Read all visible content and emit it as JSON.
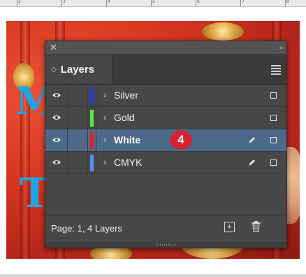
{
  "ruler": {
    "numbers": [
      "2",
      "3",
      "4",
      "5",
      "6",
      "7",
      "8"
    ]
  },
  "canvas": {
    "letters": [
      "M",
      "T"
    ]
  },
  "panel": {
    "tab_title": "Layers",
    "tab_icon": "up-down-arrows-icon",
    "close_glyph": "✕",
    "collapse_glyph": "‹‹",
    "menu_icon": "hamburger-menu-icon"
  },
  "layers": [
    {
      "name": "Silver",
      "color": "#2a3bd6",
      "visible": true,
      "locked": false,
      "selected": false,
      "pen": false
    },
    {
      "name": "Gold",
      "color": "#5ee64a",
      "visible": true,
      "locked": false,
      "selected": false,
      "pen": false
    },
    {
      "name": "White",
      "color": "#e01e26",
      "visible": true,
      "locked": false,
      "selected": true,
      "pen": true
    },
    {
      "name": "CMYK",
      "color": "#4d90f0",
      "visible": true,
      "locked": false,
      "selected": false,
      "pen": true
    }
  ],
  "callout": {
    "number": "4",
    "color": "#d32333"
  },
  "footer": {
    "status": "Page: 1, 4 Layers",
    "new_layer_icon": "new-layer-icon",
    "delete_icon": "trash-icon"
  },
  "colors": {
    "panel_bg": "#474747",
    "selected_row": "#4e6a8a"
  }
}
